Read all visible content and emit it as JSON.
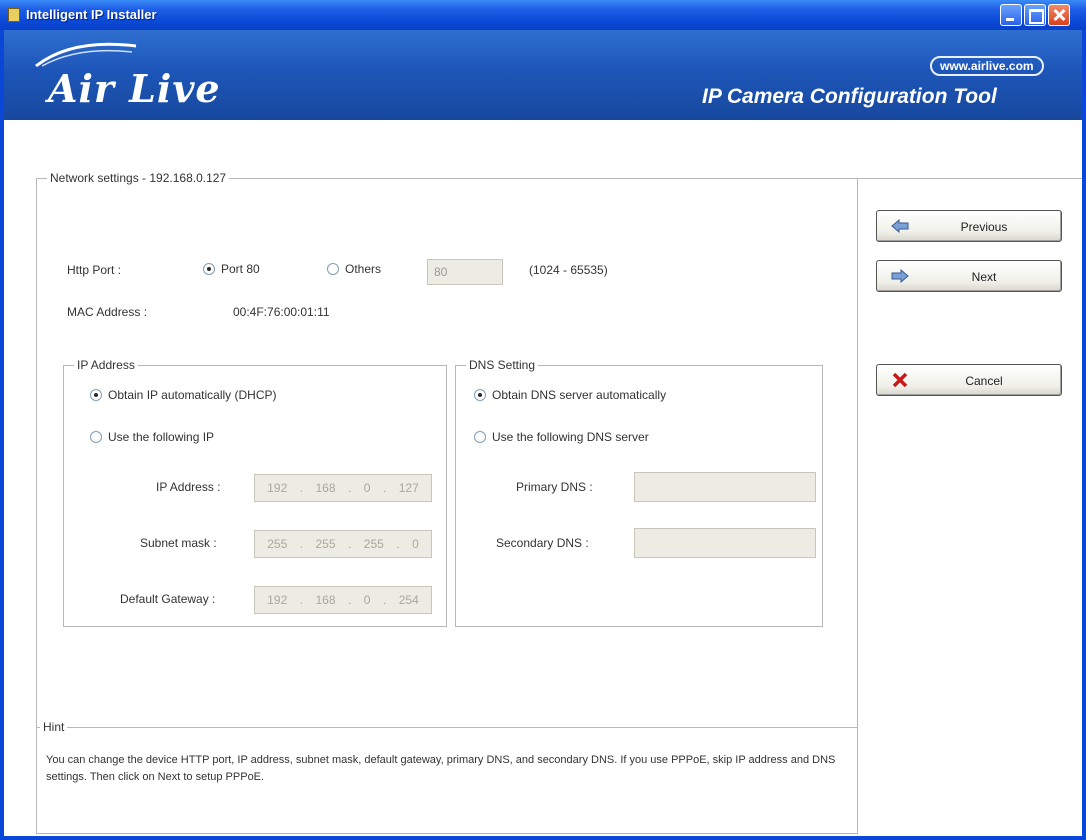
{
  "window": {
    "title": "Intelligent IP Installer"
  },
  "banner": {
    "logo": "Air Live",
    "url": "www.airlive.com",
    "tool_title": "IP Camera Configuration Tool"
  },
  "network": {
    "legend": "Network settings - 192.168.0.127",
    "http_port_label": "Http Port :",
    "port80_label": "Port 80",
    "others_label": "Others",
    "port_value": "80",
    "port_range": "(1024 - 65535)",
    "mac_label": "MAC Address :",
    "mac_value": "00:4F:76:00:01:11"
  },
  "ip_group": {
    "legend": "IP Address",
    "dhcp_label": "Obtain IP automatically (DHCP)",
    "static_label": "Use the following IP",
    "ip_label": "IP Address :",
    "ip_value": [
      "192",
      "168",
      "0",
      "127"
    ],
    "subnet_label": "Subnet mask :",
    "subnet_value": [
      "255",
      "255",
      "255",
      "0"
    ],
    "gateway_label": "Default Gateway :",
    "gateway_value": [
      "192",
      "168",
      "0",
      "254"
    ]
  },
  "dns_group": {
    "legend": "DNS Setting",
    "auto_label": "Obtain DNS server automatically",
    "manual_label": "Use the following DNS server",
    "primary_label": "Primary DNS :",
    "secondary_label": "Secondary DNS :"
  },
  "hint": {
    "legend": "Hint",
    "text": "You can change the device HTTP port, IP address, subnet mask, default gateway, primary DNS, and secondary DNS. If you use PPPoE, skip IP address and DNS settings. Then click on Next to setup PPPoE."
  },
  "buttons": {
    "previous": "Previous",
    "next": "Next",
    "cancel": "Cancel"
  },
  "icons": {
    "previous": "arrow-left-icon",
    "next": "arrow-right-icon",
    "cancel": "x-cross-icon"
  },
  "colors": {
    "titlebar": "#0a4ad8",
    "banner": "#1d56b8",
    "cancel_icon": "#c81818"
  }
}
